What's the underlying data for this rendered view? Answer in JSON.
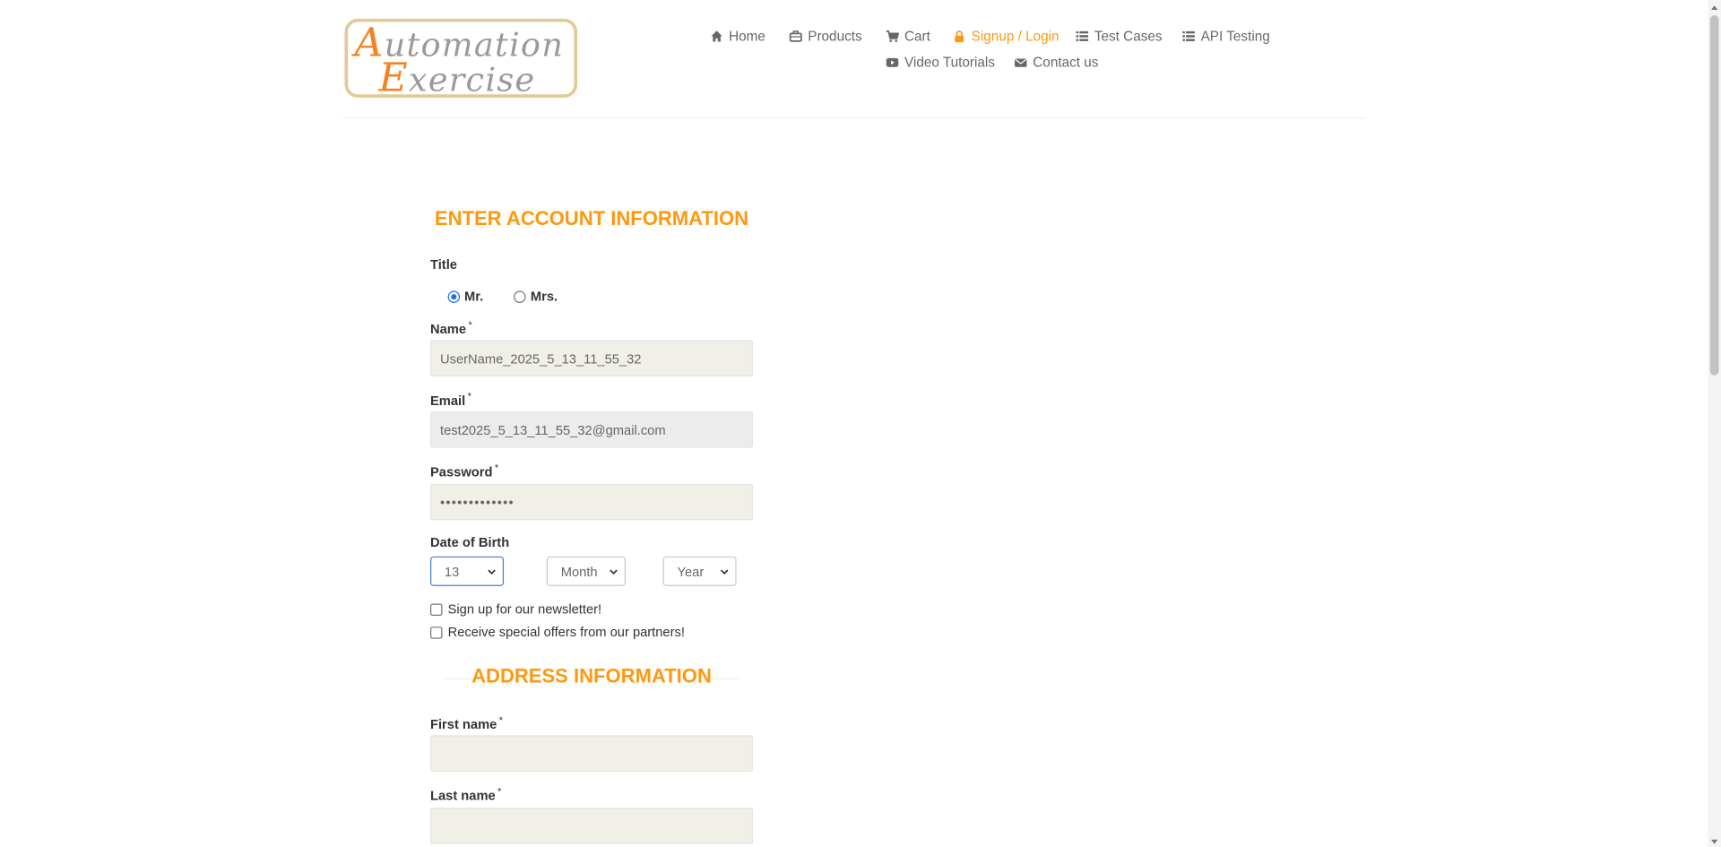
{
  "logo": {
    "line1_cap": "A",
    "line1_rest": "utomation",
    "line2_cap": "E",
    "line2_rest": "xercise"
  },
  "nav": {
    "items": [
      {
        "label": "Home",
        "icon": "home-icon"
      },
      {
        "label": "Products",
        "icon": "briefcase-icon"
      },
      {
        "label": "Cart",
        "icon": "cart-icon"
      },
      {
        "label": "Signup / Login",
        "icon": "lock-icon",
        "active": true
      },
      {
        "label": "Test Cases",
        "icon": "list-icon"
      },
      {
        "label": "API Testing",
        "icon": "list-icon"
      },
      {
        "label": "Video Tutorials",
        "icon": "youtube-play-icon"
      },
      {
        "label": "Contact us",
        "icon": "envelope-icon"
      }
    ]
  },
  "colors": {
    "accent": "#fe980f",
    "logo_border": "#e0cb96",
    "input_bg": "#f0f0e9",
    "focus": "#4a7bd6"
  },
  "account": {
    "heading": "ENTER ACCOUNT INFORMATION",
    "title_label": "Title",
    "title_options": [
      {
        "label": "Mr.",
        "checked": true
      },
      {
        "label": "Mrs.",
        "checked": false
      }
    ],
    "name_label": "Name",
    "name_value": "UserName_2025_5_13_11_55_32",
    "email_label": "Email",
    "email_value": "test2025_5_13_11_55_32@gmail.com",
    "password_label": "Password",
    "password_value": "•••••••••••••",
    "dob_label": "Date of Birth",
    "dob_day": "13",
    "dob_month": "Month",
    "dob_year": "Year",
    "newsletter_label": "Sign up for our newsletter!",
    "offers_label": "Receive special offers from our partners!",
    "required_mark": "*"
  },
  "address": {
    "heading": "ADDRESS INFORMATION",
    "first_name_label": "First name",
    "last_name_label": "Last name"
  }
}
